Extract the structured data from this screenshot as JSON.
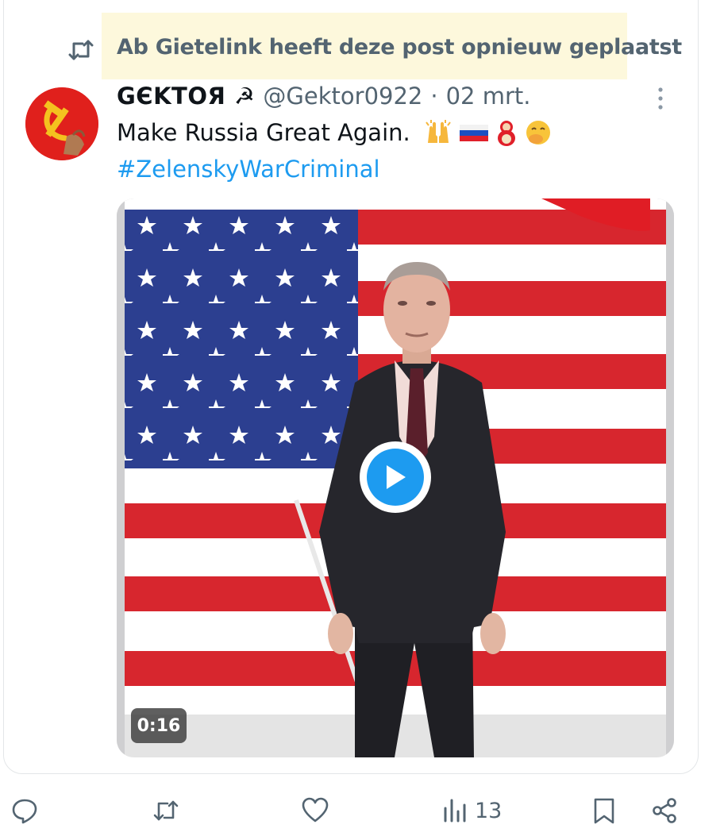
{
  "repost": {
    "text": "Ab Gietelink heeft deze post opnieuw geplaatst",
    "icon": "repost-icon"
  },
  "tweet": {
    "display_name": "GЄKTOЯ ☭",
    "handle": "@Gektor0922",
    "separator": "·",
    "date": "02 mrt.",
    "text": "Make Russia Great Again.",
    "emojis": [
      "raising-hands",
      "russia-flag",
      "nesting-doll",
      "hand-over-mouth-face"
    ],
    "hashtag": "#ZelenskyWarCriminal",
    "avatar_icon": "hammer-and-sickle-icon",
    "more_icon": "more-vertical-icon"
  },
  "media": {
    "type": "video",
    "duration": "0:16",
    "play_icon": "play-icon"
  },
  "actions": {
    "reply_icon": "reply-icon",
    "repost_icon": "repost-icon",
    "like_icon": "heart-icon",
    "views_icon": "views-icon",
    "views_count": "13",
    "bookmark_icon": "bookmark-icon",
    "share_icon": "share-icon"
  },
  "colors": {
    "accent": "#1d9bf0",
    "secondary_text": "#536471",
    "repost_highlight": "#fdf8dc"
  }
}
